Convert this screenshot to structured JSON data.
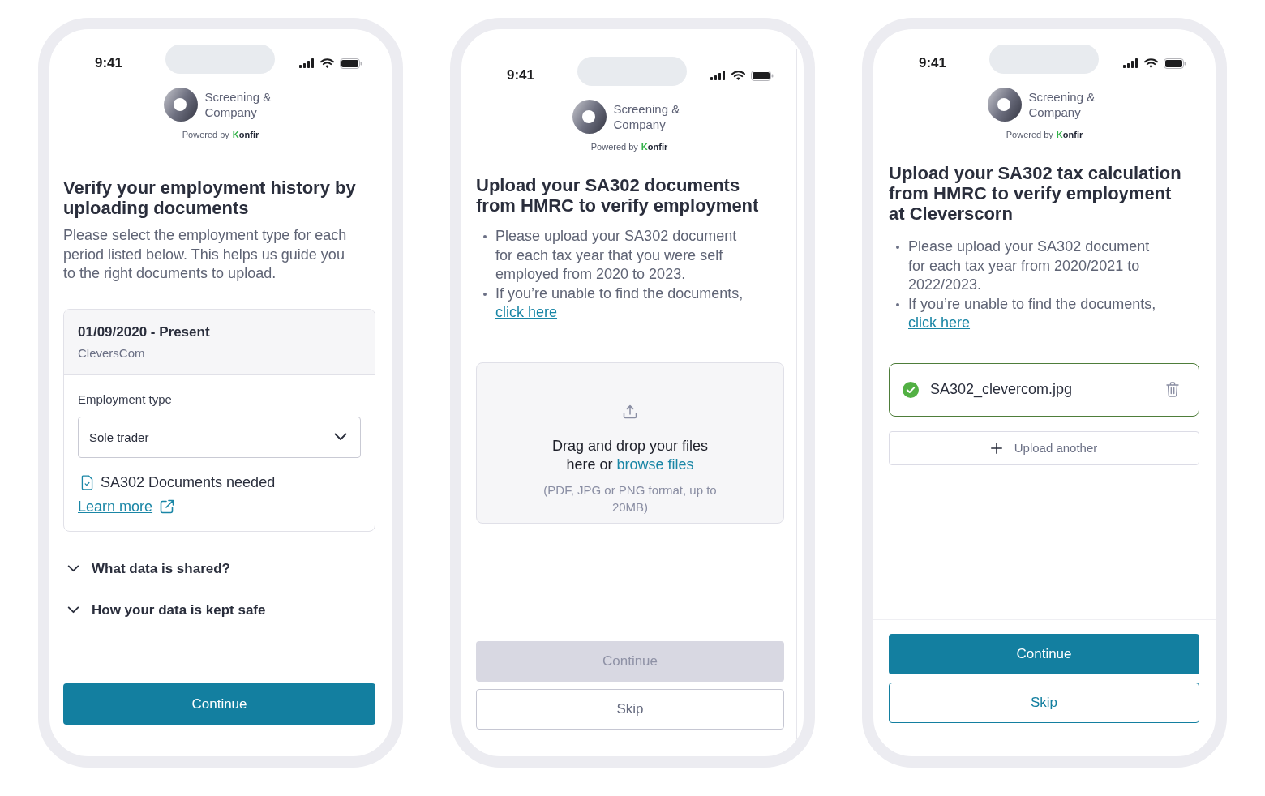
{
  "phones": [
    {
      "status_bar": {
        "time": "9:41"
      },
      "brand": {
        "name": "Screening & Company",
        "powered_by": "Powered by",
        "partner": "Konfir"
      },
      "title": "Verify your employment history by uploading documents",
      "description": "Please select the employment type for each period listed below. This helps us guide you to the right documents to upload.",
      "period_card": {
        "period": "01/09/2020 - Present",
        "employer": "CleversCom",
        "field_label": "Employment type",
        "select_value": "Sole trader",
        "requirement": "SA302 Documents needed",
        "link": "Learn more"
      },
      "accordions": [
        {
          "label": "What data is shared?",
          "expanded": false
        },
        {
          "label": "How your data is kept safe",
          "expanded": false
        }
      ],
      "buttons": [
        {
          "label": "Continue",
          "kind": "primary",
          "disabled": false
        }
      ]
    },
    {
      "status_bar": {
        "time": "9:41"
      },
      "brand": {
        "name": "Screening & Company",
        "powered_by": "Powered by",
        "partner": "Konfir"
      },
      "title": "Upload your SA302 documents from HMRC to verify employment",
      "bullets": [
        {
          "text": "Please upload your SA302 document for each tax year that you were self employed from 2020 to 2023."
        },
        {
          "text": "If you’re unable to find the documents,",
          "link": "click here"
        }
      ],
      "dropzone": {
        "text": "Drag and drop your files here or",
        "link": "browse files",
        "hint": "(PDF, JPG or PNG format, up to 20MB)"
      },
      "buttons": [
        {
          "label": "Continue",
          "kind": "primary",
          "disabled": true
        },
        {
          "label": "Skip",
          "kind": "neutral",
          "disabled": false
        }
      ]
    },
    {
      "status_bar": {
        "time": "9:41"
      },
      "brand": {
        "name": "Screening & Company",
        "powered_by": "Powered by",
        "partner": "Konfir"
      },
      "title": "Upload your SA302 tax calculation from HMRC to verify employment at Cleverscorn",
      "bullets": [
        {
          "text": "Please upload your SA302 document for each tax year from 2020/2021 to 2022/2023."
        },
        {
          "text": "If you’re unable to find the documents,",
          "link": "click here"
        }
      ],
      "files": [
        {
          "name": "SA302_clevercom.jpg",
          "uploaded": true
        }
      ],
      "upload_another": "Upload another",
      "buttons": [
        {
          "label": "Continue",
          "kind": "primary",
          "disabled": false
        },
        {
          "label": "Skip",
          "kind": "outline",
          "disabled": false
        }
      ]
    }
  ]
}
